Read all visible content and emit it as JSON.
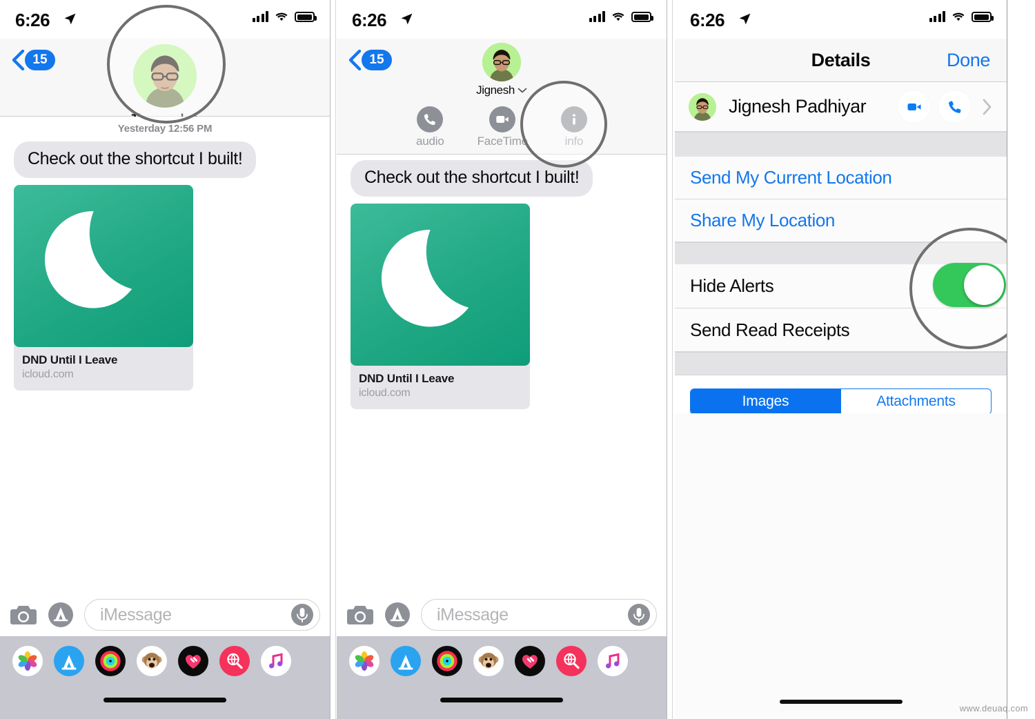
{
  "watermark": "www.deuaq.com",
  "status_bar": {
    "time": "6:26",
    "location_icon": "location-arrow-icon",
    "signal_icon": "cellular-bars-icon",
    "wifi_icon": "wifi-icon",
    "battery_icon": "battery-full-icon"
  },
  "panel1": {
    "name": "messages-conversation",
    "back": {
      "icon": "chevron-left-icon",
      "badge": "15"
    },
    "contact": {
      "name": "Jignesh",
      "disclosure_icon": "chevron-right-icon",
      "avatar": "contact-avatar"
    },
    "timestamp": "Yesterday 12:56 PM",
    "message": "Check out the shortcut I built!",
    "attachment": {
      "title": "DND Until I Leave",
      "source": "icloud.com",
      "art_icon": "crescent-moon-icon"
    },
    "compose": {
      "camera_icon": "camera-icon",
      "appstore_icon": "app-store-icon",
      "placeholder": "iMessage",
      "mic_icon": "microphone-icon"
    },
    "drawer": [
      {
        "label": "Photos",
        "icon": "photos-app-icon"
      },
      {
        "label": "App Store",
        "icon": "app-store-app-icon"
      },
      {
        "label": "Activity",
        "icon": "activity-rings-app-icon"
      },
      {
        "label": "Animoji",
        "icon": "monkey-animoji-icon"
      },
      {
        "label": "Digital Touch",
        "icon": "digital-touch-app-icon"
      },
      {
        "label": "Images",
        "icon": "images-search-app-icon"
      },
      {
        "label": "Music",
        "icon": "music-app-icon"
      }
    ],
    "highlight": "contact-name-highlight"
  },
  "panel2": {
    "name": "messages-contact-expanded",
    "back": {
      "icon": "chevron-left-icon",
      "badge": "15"
    },
    "contact": {
      "name": "Jignesh",
      "disclosure_icon": "chevron-down-icon"
    },
    "actions": [
      {
        "label": "audio",
        "icon": "phone-icon"
      },
      {
        "label": "FaceTime",
        "icon": "video-camera-icon"
      },
      {
        "label": "info",
        "icon": "info-icon"
      }
    ],
    "message": "Check out the shortcut I built!",
    "attachment": {
      "title": "DND Until I Leave",
      "source": "icloud.com",
      "art_icon": "crescent-moon-icon"
    },
    "compose": {
      "camera_icon": "camera-icon",
      "appstore_icon": "app-store-icon",
      "placeholder": "iMessage",
      "mic_icon": "microphone-icon"
    },
    "highlight": "info-button-highlight"
  },
  "panel3": {
    "name": "conversation-details",
    "nav": {
      "title": "Details",
      "done_label": "Done"
    },
    "contact": {
      "name": "Jignesh Padhiyar",
      "video_icon": "video-camera-icon",
      "phone_icon": "phone-icon",
      "disclosure_icon": "chevron-right-icon"
    },
    "rows": [
      {
        "label": "Send My Current Location",
        "style": "link",
        "name": "send-current-location-row"
      },
      {
        "label": "Share My Location",
        "style": "link",
        "name": "share-my-location-row"
      },
      {
        "label": "Hide Alerts",
        "style": "plain",
        "name": "hide-alerts-row",
        "toggle": true,
        "toggle_on": true
      },
      {
        "label": "Send Read Receipts",
        "style": "plain",
        "name": "send-read-receipts-row",
        "toggle": false
      }
    ],
    "segments": [
      {
        "label": "Images",
        "selected": true
      },
      {
        "label": "Attachments",
        "selected": false
      }
    ],
    "highlight": "hide-alerts-toggle-highlight"
  },
  "colors": {
    "accent_blue": "#1377ed",
    "toggle_green": "#34c759",
    "bubble_gray": "#e6e5ea",
    "card_green": "#21a884",
    "drawer_gray": "#c6c7cf"
  }
}
